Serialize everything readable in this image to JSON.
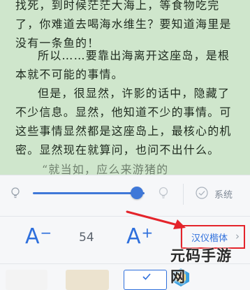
{
  "reader": {
    "paragraphs": [
      "找死，到时候茫茫大海上，等食物吃完了，你难道去喝海水维生？要知道海里是没有一条鱼的！",
      "所以……要靠出海离开这座岛，是根本就不可能的事情。",
      "但是，很显然，许影的话中，隐藏了不少信息。显然，他知道不少的事情。可这些事情显然都是这座岛上，最核心的机密。显然现在就算问，也问不出什么。",
      "“就当如，应么来游猪的"
    ]
  },
  "settings": {
    "brightness": {
      "level": 0.93
    },
    "system_label": "系统",
    "font": {
      "decrease_label": "A",
      "decrease_op": "−",
      "size": "54",
      "increase_label": "A",
      "increase_op": "+",
      "face_label": "汉仪楷体",
      "face_chevron": "›"
    }
  },
  "themes": [
    "#f3f3f3",
    "#ffffff",
    "#ece3cf",
    "#ffffff",
    "#ffffff"
  ],
  "colors": {
    "accent": "#2e6fdc",
    "highlight": "#e4242b",
    "reader_bg": "#cfe6cc"
  },
  "watermark": {
    "text": "元码手游网"
  }
}
